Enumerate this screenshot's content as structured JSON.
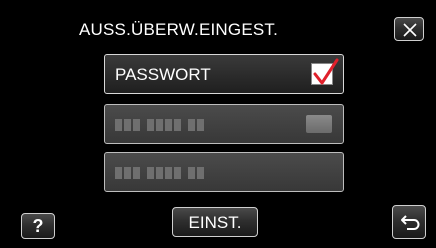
{
  "screen": {
    "title": "AUSS.ÜBERW.EINGEST."
  },
  "options": [
    {
      "label": "PASSWORT",
      "checked": true,
      "enabled": true,
      "has_checkbox": true
    },
    {
      "label": "",
      "enabled": false,
      "has_toggle_indicator": true,
      "obscured_label": true
    },
    {
      "label": "",
      "enabled": false,
      "obscured_label": true
    }
  ],
  "buttons": {
    "help_label": "?",
    "set_label": "EINST.",
    "close_icon": "close-icon",
    "back_icon": "return-arrow-icon"
  },
  "colors": {
    "background": "#000000",
    "check_mark": "#e0202b",
    "button_border": "#cfcfcf"
  }
}
